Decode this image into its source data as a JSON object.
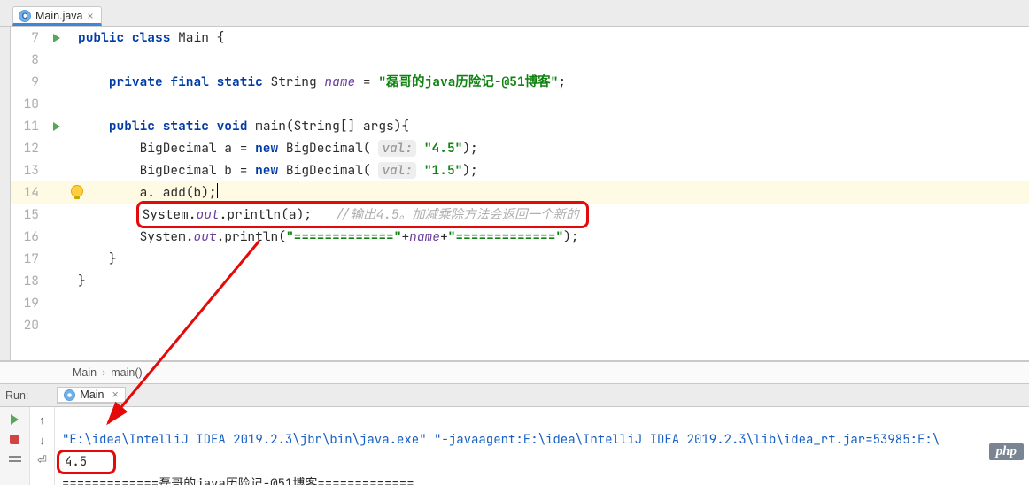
{
  "tab": {
    "filename": "Main.java",
    "close": "×"
  },
  "gutter": {
    "start": 7
  },
  "code": {
    "l7": {
      "t1": "public class",
      "t2": " Main {"
    },
    "l9": {
      "t1": "private final static",
      "t2": " String ",
      "name": "name",
      "eq": " = ",
      "str": "\"磊哥的java历险记-@51博客\"",
      "end": ";"
    },
    "l11": {
      "t1": "public static void",
      "t2": " main(String[] args){"
    },
    "l12": {
      "a": "BigDecimal a = ",
      "new": "new",
      "b": " BigDecimal(",
      "hint": "val:",
      "str": "\"4.5\"",
      "end": ");"
    },
    "l13": {
      "a": "BigDecimal b = ",
      "new": "new",
      "b": " BigDecimal(",
      "hint": "val:",
      "str": "\"1.5\"",
      "end": ");"
    },
    "l14": {
      "a": "a. add(b);"
    },
    "l15": {
      "a": "System.",
      "out": "out",
      "b": ".println(a);   ",
      "cmnt": "//输出4.5。加减乘除方法会返回一个新的"
    },
    "l16": {
      "a": "System.",
      "out": "out",
      "b": ".println(",
      "s1": "\"=============\"",
      "p1": "+",
      "name": "name",
      "p2": "+",
      "s2": "\"=============\"",
      "end": ");"
    },
    "l17": {
      "br": "}"
    },
    "l18": {
      "br": "}"
    }
  },
  "breadcrumb": {
    "a": "Main",
    "b": "main()"
  },
  "run": {
    "label": "Run:",
    "tabname": "Main",
    "cmd_a": "\"E:\\idea\\IntelliJ IDEA 2019.2.3\\jbr\\bin\\java.exe\"",
    "cmd_b": " \"-javaagent:E:\\idea\\IntelliJ IDEA 2019.2.3\\lib\\idea_rt.jar=53985:E:\\",
    "out1": "4.5",
    "out2": "=============磊哥的java历险记-@51博客============="
  },
  "badge": {
    "php": "php"
  }
}
